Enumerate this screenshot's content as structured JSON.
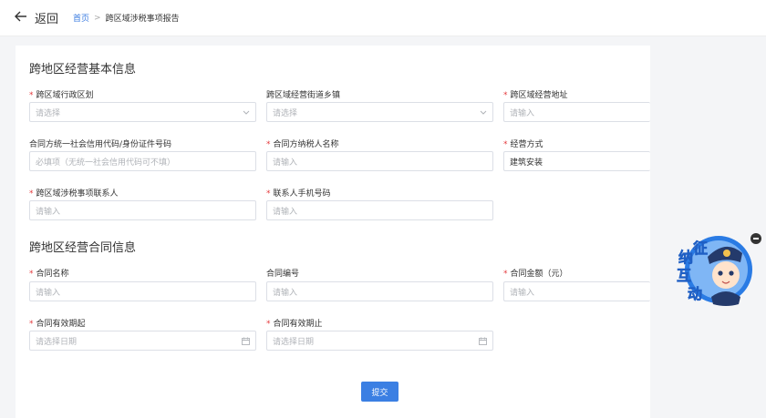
{
  "header": {
    "back_label": "返回",
    "breadcrumb_home": "首页",
    "breadcrumb_separator": ">",
    "breadcrumb_current": "跨区域涉税事项报告"
  },
  "basic": {
    "title": "跨地区经营基本信息",
    "admin_region": {
      "label": "跨区域行政区划",
      "placeholder": "请选择",
      "required": true
    },
    "street_town": {
      "label": "跨区域经营街道乡镇",
      "placeholder": "请选择",
      "required": false
    },
    "address": {
      "label": "跨区域经营地址",
      "placeholder": "请输入",
      "required": true
    },
    "credit_code": {
      "label": "合同方统一社会信用代码/身份证件号码",
      "placeholder": "必填项（无统一社会信用代码可不填）",
      "required": false
    },
    "taxpayer_name": {
      "label": "合同方纳税人名称",
      "placeholder": "请输入",
      "required": true
    },
    "business_mode": {
      "label": "经营方式",
      "value": "建筑安装",
      "required": true
    },
    "contact": {
      "label": "跨区域涉税事项联系人",
      "placeholder": "请输入",
      "required": true
    },
    "phone": {
      "label": "联系人手机号码",
      "placeholder": "请输入",
      "required": true
    }
  },
  "contract": {
    "title": "跨地区经营合同信息",
    "name": {
      "label": "合同名称",
      "placeholder": "请输入",
      "required": true
    },
    "number": {
      "label": "合同编号",
      "placeholder": "请输入",
      "required": false
    },
    "amount": {
      "label": "合同金额（元）",
      "placeholder": "请输入",
      "required": true
    },
    "start_date": {
      "label": "合同有效期起",
      "placeholder": "请选择日期",
      "required": true
    },
    "end_date": {
      "label": "合同有效期止",
      "placeholder": "请选择日期",
      "required": true
    }
  },
  "submit_label": "提交",
  "required_mark": "*",
  "mascot": {
    "chars": [
      "征",
      "纳",
      "互",
      "动"
    ],
    "colors": {
      "ring": "#2a7be4",
      "text": "#1f5fc4",
      "face": "#ffe3cc",
      "cap": "#243a6b"
    }
  },
  "icons": {
    "back": "arrow-left-icon",
    "select": "chevron-down-icon",
    "date": "calendar-icon",
    "close_widget": "minus-circle-icon"
  },
  "colors": {
    "primary": "#3b7fe3",
    "link": "#3a7be0",
    "required": "#e4393c",
    "border": "#dcdfe6",
    "page_bg": "#f4f5f7"
  }
}
